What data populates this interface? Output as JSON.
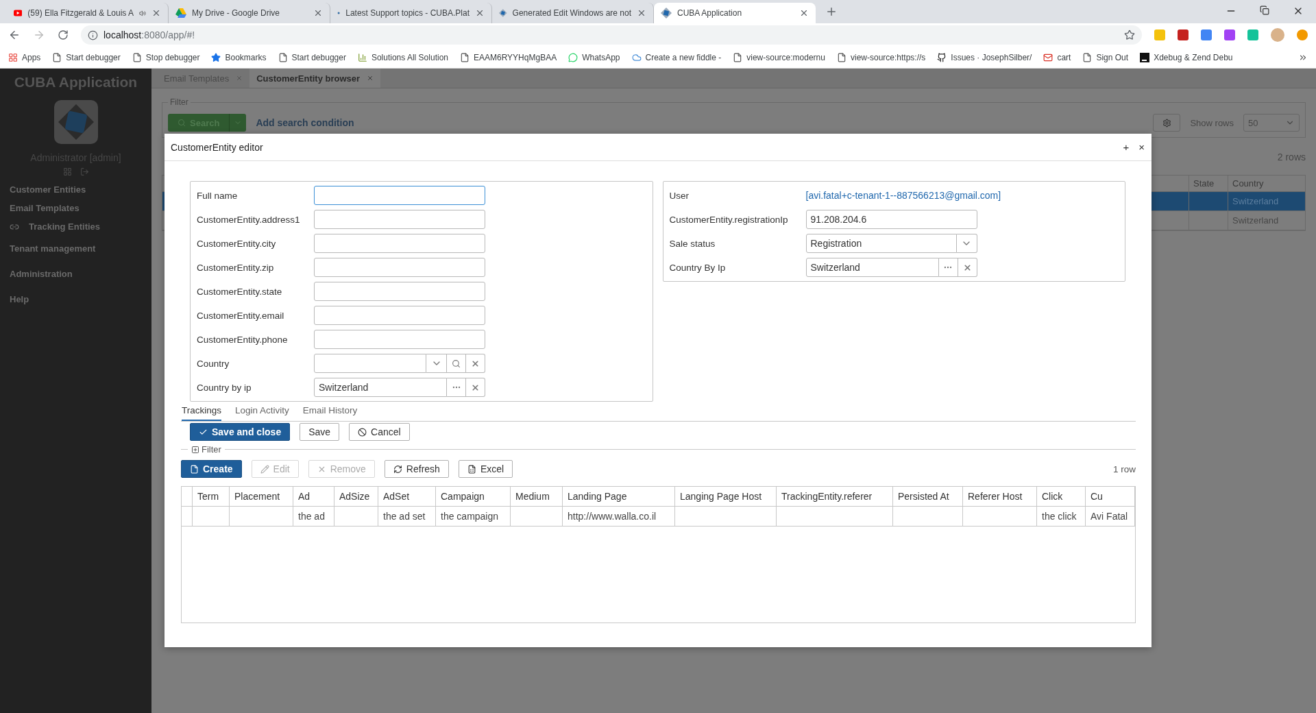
{
  "browser": {
    "tabs": [
      {
        "title": "(59) Ella Fitzgerald & Louis A",
        "kind": "youtube",
        "audio": true,
        "selected": false
      },
      {
        "title": "My Drive - Google Drive",
        "kind": "drive",
        "audio": false,
        "selected": false
      },
      {
        "title": "Latest Support topics - CUBA.Plat",
        "kind": "cuba",
        "audio": false,
        "selected": false
      },
      {
        "title": "Generated Edit Windows are not",
        "kind": "cuba",
        "audio": false,
        "selected": false
      },
      {
        "title": "CUBA Application",
        "kind": "cuba",
        "audio": false,
        "selected": true
      }
    ],
    "address": {
      "host": "localhost",
      "path": ":8080/app/#!"
    },
    "bookmarks": [
      {
        "label": "Apps",
        "kind": "apps"
      },
      {
        "label": "Start debugger",
        "kind": "page"
      },
      {
        "label": "Stop debugger",
        "kind": "page"
      },
      {
        "label": "Bookmarks",
        "kind": "star"
      },
      {
        "label": "Start debugger",
        "kind": "page"
      },
      {
        "label": "Solutions All Solution",
        "kind": "chart"
      },
      {
        "label": "EAAM6RYYHqMgBAA",
        "kind": "page"
      },
      {
        "label": "WhatsApp",
        "kind": "chat"
      },
      {
        "label": "Create a new fiddle -",
        "kind": "cloud"
      },
      {
        "label": "view-source:modernu",
        "kind": "page"
      },
      {
        "label": "view-source:https://s",
        "kind": "page"
      },
      {
        "label": "Issues · JosephSilber/",
        "kind": "cat"
      },
      {
        "label": "cart",
        "kind": "mail"
      },
      {
        "label": "Sign Out",
        "kind": "page"
      },
      {
        "label": "Xdebug & Zend Debu",
        "kind": "jb"
      }
    ]
  },
  "sidebar": {
    "title": "CUBA Application",
    "user": "Administrator [admin]",
    "items": [
      {
        "label": "Customer Entities",
        "kind": "item"
      },
      {
        "label": "Email Templates",
        "kind": "item"
      },
      {
        "label": "Tracking Entities",
        "kind": "linked"
      },
      {
        "label": "Tenant management",
        "kind": "group"
      },
      {
        "label": "Administration",
        "kind": "group"
      },
      {
        "label": "Help",
        "kind": "group"
      }
    ]
  },
  "app_tabs": [
    {
      "label": "Email Templates",
      "selected": false
    },
    {
      "label": "CustomerEntity browser",
      "selected": true
    }
  ],
  "browser_filter": {
    "caption": "Filter",
    "search": "Search",
    "add_condition": "Add search condition",
    "show_rows": "Show rows",
    "rows_value": "50"
  },
  "browser_count": "2 rows",
  "browser_table": {
    "columns": [
      "State",
      "Country"
    ],
    "rows": [
      {
        "country": "Switzerland",
        "selected": true
      },
      {
        "country": "Switzerland",
        "selected": false
      }
    ]
  },
  "dialog": {
    "title": "CustomerEntity editor",
    "maximize": "+",
    "close": "×",
    "left_fields": [
      {
        "label": "Full name",
        "kind": "text",
        "focused": true
      },
      {
        "label": "CustomerEntity.address1",
        "kind": "text",
        "focused": false
      },
      {
        "label": "CustomerEntity.city",
        "kind": "text",
        "focused": false
      },
      {
        "label": "CustomerEntity.zip",
        "kind": "text",
        "focused": false
      },
      {
        "label": "CustomerEntity.state",
        "kind": "text",
        "focused": false
      },
      {
        "label": "CustomerEntity.email",
        "kind": "text",
        "focused": false
      },
      {
        "label": "CustomerEntity.phone",
        "kind": "text",
        "focused": false
      },
      {
        "label": "Country",
        "kind": "lookup",
        "focused": false
      },
      {
        "label": "Country by ip",
        "kind": "picker",
        "value": "Switzerland",
        "focused": false
      }
    ],
    "right_fields": [
      {
        "label": "User",
        "kind": "link",
        "value": "[avi.fatal+c-tenant-1--887566213@gmail.com]"
      },
      {
        "label": "CustomerEntity.registrationIp",
        "kind": "text",
        "value": "91.208.204.6",
        "focused": false
      },
      {
        "label": "Sale status",
        "kind": "select",
        "value": "Registration"
      },
      {
        "label": "Country By Ip",
        "kind": "picker",
        "value": "Switzerland"
      }
    ],
    "tabs": [
      {
        "label": "Trackings",
        "selected": true
      },
      {
        "label": "Login Activity",
        "selected": false
      },
      {
        "label": "Email History",
        "selected": false
      }
    ],
    "buttons": [
      {
        "label": "Save and close",
        "kind": "primary-check"
      },
      {
        "label": "Save",
        "kind": "plain"
      },
      {
        "label": "Cancel",
        "kind": "cancel"
      }
    ],
    "filter": "Filter",
    "actions": [
      {
        "label": "Create",
        "kind": "create",
        "disabled": false
      },
      {
        "label": "Edit",
        "kind": "edit",
        "disabled": true
      },
      {
        "label": "Remove",
        "kind": "remove",
        "disabled": true
      },
      {
        "label": "Refresh",
        "kind": "refresh",
        "disabled": false
      },
      {
        "label": "Excel",
        "kind": "excel",
        "disabled": false
      }
    ],
    "count": "1 row",
    "table": {
      "columns": [
        "Term",
        "Placement",
        "Ad",
        "AdSize",
        "AdSet",
        "Campaign",
        "Medium",
        "Landing Page",
        "Langing Page Host",
        "TrackingEntity.referer",
        "Persisted At",
        "Referer Host",
        "Click",
        "Cu"
      ],
      "rows": [
        {
          "cells": [
            null,
            null,
            "the ad",
            null,
            "the ad set",
            "the campaign",
            null,
            "http://www.walla.co.il",
            null,
            null,
            null,
            null,
            "the click",
            "Avi Fatal"
          ]
        }
      ]
    }
  }
}
